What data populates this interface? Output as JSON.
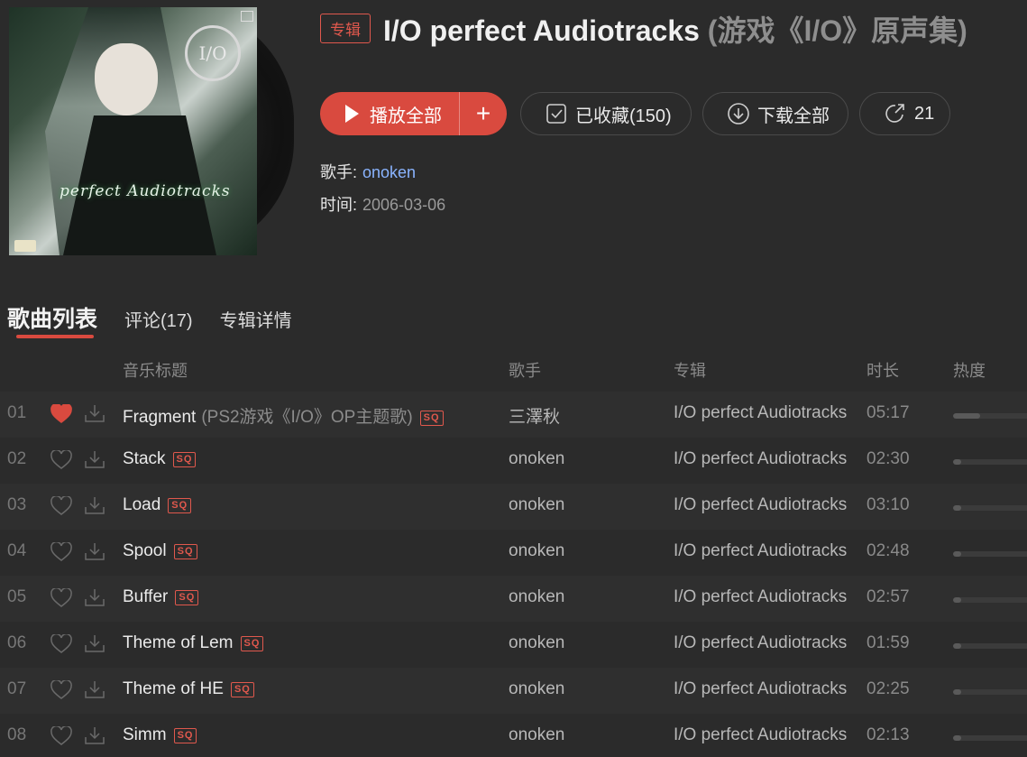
{
  "album": {
    "tag": "专辑",
    "title": "I/O perfect Audiotracks",
    "subtitle": "(游戏《I/O》原声集)",
    "cover_logo": "I/O",
    "cover_caption": "perfect Audiotracks"
  },
  "actions": {
    "play_all": "播放全部",
    "add": "+",
    "collected": "已收藏(150)",
    "download_all": "下载全部",
    "share_count": "21"
  },
  "meta": {
    "artist_label": "歌手:",
    "artist": "onoken",
    "date_label": "时间:",
    "date": "2006-03-06"
  },
  "tabs": [
    "歌曲列表",
    "评论(17)",
    "专辑详情"
  ],
  "columns": {
    "title": "音乐标题",
    "artist": "歌手",
    "album": "专辑",
    "duration": "时长",
    "heat": "热度"
  },
  "badge": "SQ",
  "tracks": [
    {
      "num": "01",
      "title": "Fragment",
      "note": "(PS2游戏《I/O》OP主题歌)",
      "artist": "三澤秋",
      "album": "I/O perfect Audiotracks",
      "duration": "05:17",
      "liked": true,
      "heat": 0.33
    },
    {
      "num": "02",
      "title": "Stack",
      "note": "",
      "artist": "onoken",
      "album": "I/O perfect Audiotracks",
      "duration": "02:30",
      "liked": false,
      "heat": 0.1
    },
    {
      "num": "03",
      "title": "Load",
      "note": "",
      "artist": "onoken",
      "album": "I/O perfect Audiotracks",
      "duration": "03:10",
      "liked": false,
      "heat": 0.1
    },
    {
      "num": "04",
      "title": "Spool",
      "note": "",
      "artist": "onoken",
      "album": "I/O perfect Audiotracks",
      "duration": "02:48",
      "liked": false,
      "heat": 0.1
    },
    {
      "num": "05",
      "title": "Buffer",
      "note": "",
      "artist": "onoken",
      "album": "I/O perfect Audiotracks",
      "duration": "02:57",
      "liked": false,
      "heat": 0.1
    },
    {
      "num": "06",
      "title": "Theme of Lem",
      "note": "",
      "artist": "onoken",
      "album": "I/O perfect Audiotracks",
      "duration": "01:59",
      "liked": false,
      "heat": 0.1
    },
    {
      "num": "07",
      "title": "Theme of HE",
      "note": "",
      "artist": "onoken",
      "album": "I/O perfect Audiotracks",
      "duration": "02:25",
      "liked": false,
      "heat": 0.1
    },
    {
      "num": "08",
      "title": "Simm",
      "note": "",
      "artist": "onoken",
      "album": "I/O perfect Audiotracks",
      "duration": "02:13",
      "liked": false,
      "heat": 0.1
    }
  ],
  "colors": {
    "accent": "#d94a3f",
    "background": "#2b2b2b",
    "link": "#8ab4ff"
  }
}
